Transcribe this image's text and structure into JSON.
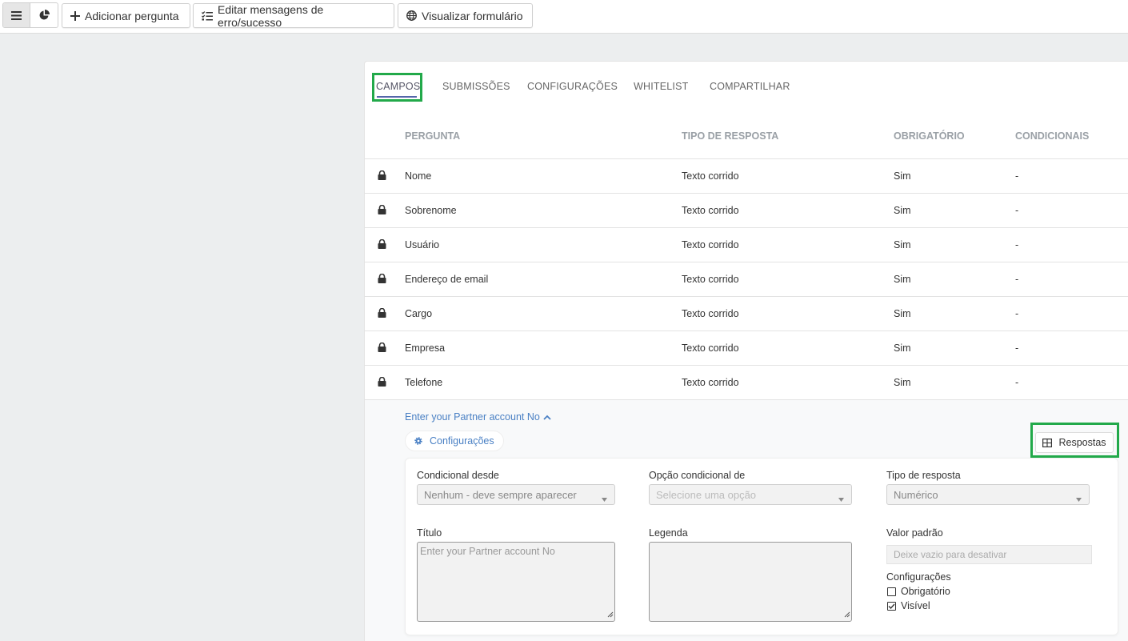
{
  "toolbar": {
    "add_question": "Adicionar pergunta",
    "edit_messages": "Editar mensagens de erro/sucesso",
    "view_form": "Visualizar formulário"
  },
  "tabs": [
    {
      "label": "CAMPOS",
      "active": true
    },
    {
      "label": "SUBMISSÕES"
    },
    {
      "label": "CONFIGURAÇÕES"
    },
    {
      "label": "WHITELIST"
    },
    {
      "label": "COMPARTILHAR"
    }
  ],
  "table": {
    "headers": [
      "PERGUNTA",
      "TIPO DE RESPOSTA",
      "OBRIGATÓRIO",
      "CONDICIONAIS"
    ],
    "rows": [
      {
        "question": "Nome",
        "type": "Texto corrido",
        "required": "Sim",
        "conditional": "-"
      },
      {
        "question": "Sobrenome",
        "type": "Texto corrido",
        "required": "Sim",
        "conditional": "-"
      },
      {
        "question": "Usuário",
        "type": "Texto corrido",
        "required": "Sim",
        "conditional": "-"
      },
      {
        "question": "Endereço de email",
        "type": "Texto corrido",
        "required": "Sim",
        "conditional": "-"
      },
      {
        "question": "Cargo",
        "type": "Texto corrido",
        "required": "Sim",
        "conditional": "-"
      },
      {
        "question": "Empresa",
        "type": "Texto corrido",
        "required": "Sim",
        "conditional": "-"
      },
      {
        "question": "Telefone",
        "type": "Texto corrido",
        "required": "Sim",
        "conditional": "-"
      }
    ]
  },
  "expanded": {
    "title": "Enter your Partner account No",
    "config_pill": "Configurações",
    "answers_button": "Respostas",
    "form": {
      "conditional_from_label": "Condicional desde",
      "conditional_from_value": "Nenhum - deve sempre aparecer",
      "conditional_option_label": "Opção condicional de",
      "conditional_option_placeholder": "Selecione uma opção",
      "answer_type_label": "Tipo de resposta",
      "answer_type_value": "Numérico",
      "title_label": "Título",
      "title_placeholder": "Enter your  Partner account No",
      "caption_label": "Legenda",
      "default_label": "Valor padrão",
      "default_placeholder": "Deixe vazio para desativar",
      "settings_label": "Configurações",
      "required_label": "Obrigatório",
      "required_checked": false,
      "visible_label": "Visível",
      "visible_checked": true
    }
  },
  "colors": {
    "highlight": "#22a94a",
    "link": "#4a80c4",
    "tab_underline": "#5566aa"
  }
}
